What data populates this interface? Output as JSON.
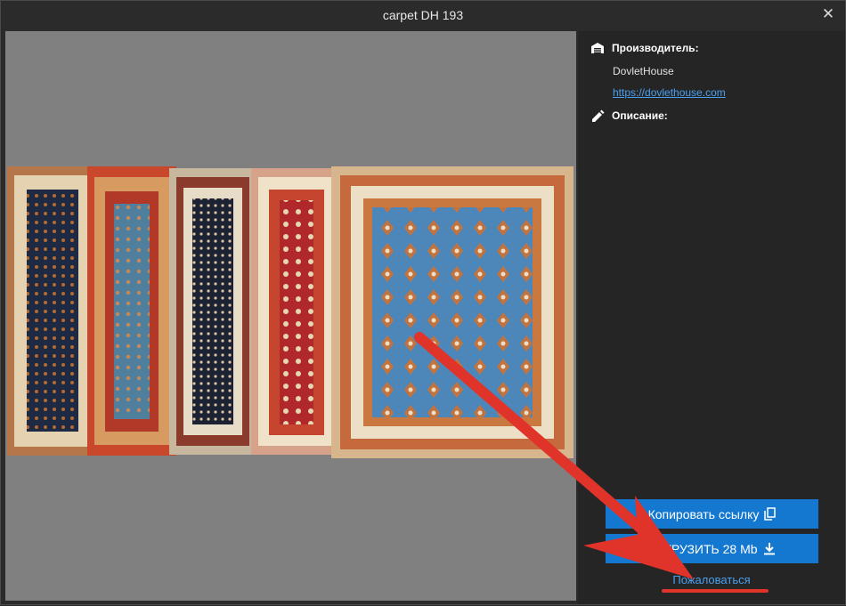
{
  "window": {
    "title": "carpet DH 193",
    "close_label": "✕"
  },
  "info": {
    "manufacturer_label": "Производитель:",
    "manufacturer_name": "DovletHouse",
    "manufacturer_url": "https://dovlethouse.com",
    "description_label": "Описание:"
  },
  "actions": {
    "copy_link": "Копировать ссылку",
    "download": "ЗАГРУЗИТЬ 28 Mb",
    "complain": "Пожаловаться"
  },
  "icons": {
    "manufacturer": "warehouse-icon",
    "description": "pencil-icon",
    "copy": "copy-icon",
    "download": "download-icon",
    "close": "close-icon"
  },
  "colors": {
    "accent": "#1478d0",
    "link": "#4aa0ee",
    "annotation": "#e0332a"
  }
}
